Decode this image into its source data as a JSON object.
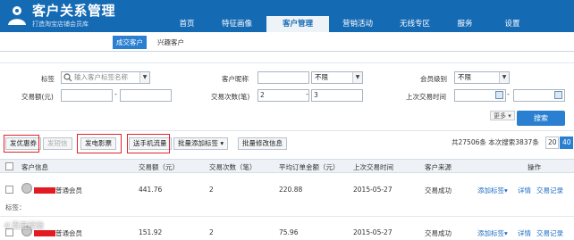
{
  "header": {
    "title": "客户关系管理",
    "subtitle": "打造淘宝店铺会员库",
    "nav": [
      {
        "label": "首页",
        "active": false
      },
      {
        "label": "特征画像",
        "active": false
      },
      {
        "label": "客户管理",
        "active": true
      },
      {
        "label": "营销活动",
        "active": false
      },
      {
        "label": "无线专区",
        "active": false
      },
      {
        "label": "服务",
        "active": false
      },
      {
        "label": "设置",
        "active": false
      }
    ]
  },
  "subtabs": {
    "active": "成交客户",
    "other": "兴趣客户"
  },
  "filters": {
    "tags_label": "标签",
    "tags_placeholder": "输入客户标签名称",
    "nick_label": "客户昵称",
    "nick_value": "",
    "nick_select": "不限",
    "level_label": "会员级别",
    "level_select": "不限",
    "amount_label": "交易额(元)",
    "amount_from": "",
    "amount_to": "",
    "dash": "-",
    "count_label": "交易次数(笔)",
    "count_from": "2",
    "count_to": "3",
    "last_time_label": "上次交易时间",
    "last_time_from": "",
    "last_time_to": "",
    "more_label": "更多",
    "search_label": "搜索"
  },
  "toolbar": {
    "coupon": "发优惠券",
    "sms": "发短信",
    "ecoupon": "发电影票",
    "flow": "送手机流量",
    "batch_tag": "批量添加标签",
    "batch_info": "批量修改信息",
    "summary": "共27506条 本次搜索3837条",
    "page_sizes": [
      "20",
      "40"
    ],
    "active_page_size": "40"
  },
  "table": {
    "headers": {
      "info": "客户信息",
      "amount": "交易额（元）",
      "count": "交易次数（笔）",
      "avg": "平均订单金额（元）",
      "last": "上次交易时间",
      "source": "客户来源",
      "ops": "操作"
    },
    "rows": [
      {
        "level": "普通会员",
        "amount": "441.76",
        "count": "2",
        "avg": "220.88",
        "last": "2015-05-27",
        "source": "交易成功",
        "tags_label": "标签：",
        "add_tag": "添加标签",
        "detail": "详情",
        "records": "交易记录"
      },
      {
        "level": "普通会员",
        "amount": "151.92",
        "count": "2",
        "avg": "75.96",
        "last": "2015-05-27",
        "source": "交易成功",
        "add_tag": "添加标签",
        "detail": "详情",
        "records": "交易记录"
      }
    ]
  },
  "watermark": "©百度经验",
  "colors": {
    "header_bg": "#156ab4",
    "accent": "#2a7fd0",
    "highlight_box": "#e0242a",
    "link": "#1d6cc4"
  }
}
